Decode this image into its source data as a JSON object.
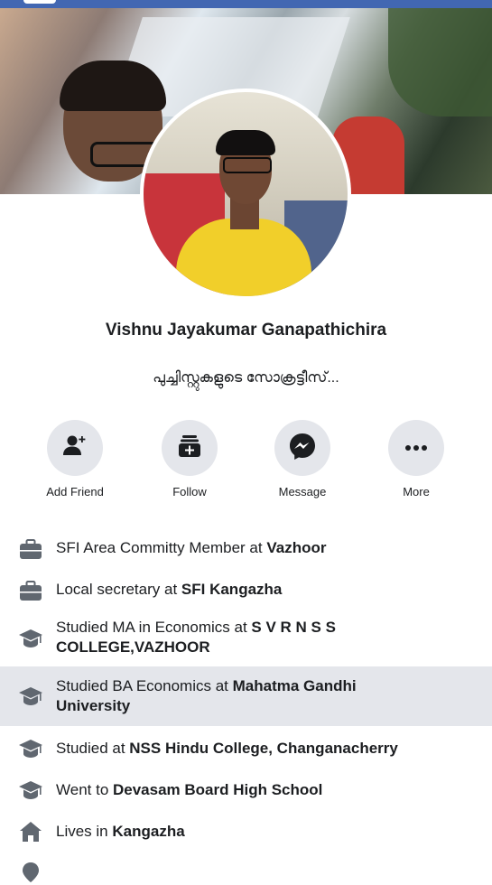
{
  "profile": {
    "name": "Vishnu Jayakumar Ganapathichira",
    "bio": "പുച്ചിസ്റ്റുകളുടെ സോക്രട്ടീസ്..."
  },
  "actions": [
    {
      "label": "Add Friend",
      "icon": "add-friend-icon"
    },
    {
      "label": "Follow",
      "icon": "follow-icon"
    },
    {
      "label": "Message",
      "icon": "messenger-icon"
    },
    {
      "label": "More",
      "icon": "more-dots-icon"
    }
  ],
  "details": [
    {
      "icon": "briefcase-icon",
      "prefix": "SFI Area Committy Member at ",
      "bold": "Vazhoor"
    },
    {
      "icon": "briefcase-icon",
      "prefix": "Local secretary at ",
      "bold": "SFI Kangazha"
    },
    {
      "icon": "graduation-cap-icon",
      "prefix": "Studied MA in Economics at ",
      "bold": "S V R N S S COLLEGE,VAZHOOR"
    },
    {
      "icon": "graduation-cap-icon",
      "prefix": "Studied BA Economics at ",
      "bold": "Mahatma Gandhi University"
    },
    {
      "icon": "graduation-cap-icon",
      "prefix": "Studied at ",
      "bold": "NSS Hindu College, Changanacherry"
    },
    {
      "icon": "graduation-cap-icon",
      "prefix": "Went to ",
      "bold": "Devasam Board High School"
    },
    {
      "icon": "home-icon",
      "prefix": "Lives in ",
      "bold": "Kangazha"
    }
  ],
  "colors": {
    "brand_blue": "#4267b2",
    "action_circle": "#e4e6eb",
    "highlight_row": "#e4e6eb",
    "icon_gray": "#606770"
  }
}
